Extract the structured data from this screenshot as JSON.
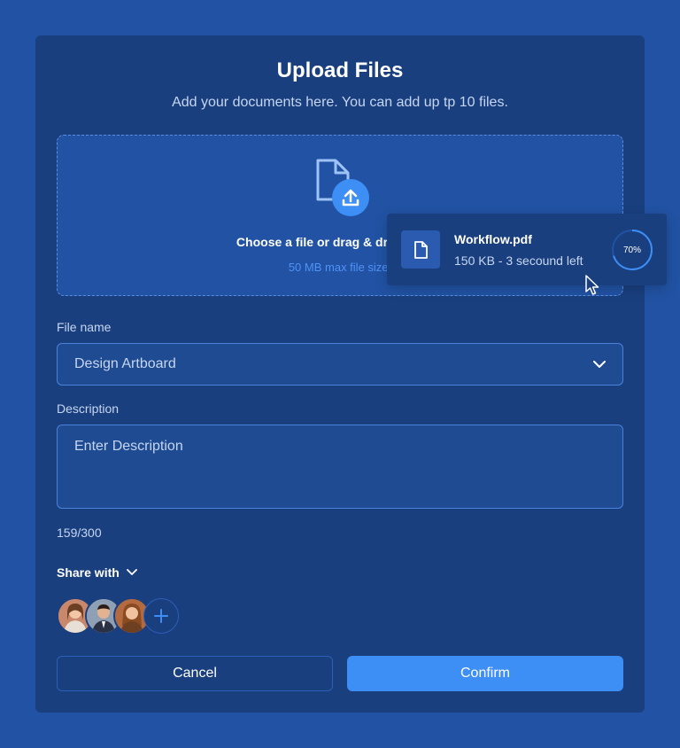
{
  "colors": {
    "background": "#2152a3",
    "panel": "#1a3f7e",
    "accent": "#3d8ef5",
    "muted_text": "#c6d6f2",
    "hint_text": "#4f93f7"
  },
  "modal": {
    "title": "Upload Files",
    "subtitle": "Add your documents here. You can add up tp 10 files."
  },
  "dropzone": {
    "icon": "file-upload-icon",
    "text": "Choose a file or drag & drop it here",
    "hint": "50 MB max file size."
  },
  "upload_item": {
    "icon": "file-icon",
    "file_name": "Workflow.pdf",
    "meta": "150 KB - 3 secound left",
    "progress_label": "70%",
    "progress_fraction": 0.7
  },
  "form": {
    "file_name_label": "File name",
    "file_name_value": "Design Artboard",
    "description_label": "Description",
    "description_placeholder": "Enter Description",
    "char_counter": "159/300"
  },
  "share": {
    "label": "Share with",
    "icon": "chevron-down-icon",
    "avatars": [
      {
        "icon": "avatar-person",
        "bg": "#c9876b"
      },
      {
        "icon": "avatar-person",
        "bg": "#8fa0b5"
      },
      {
        "icon": "avatar-person",
        "bg": "#b26a3e"
      }
    ],
    "add_icon": "plus-icon"
  },
  "actions": {
    "cancel_label": "Cancel",
    "confirm_label": "Confirm"
  }
}
